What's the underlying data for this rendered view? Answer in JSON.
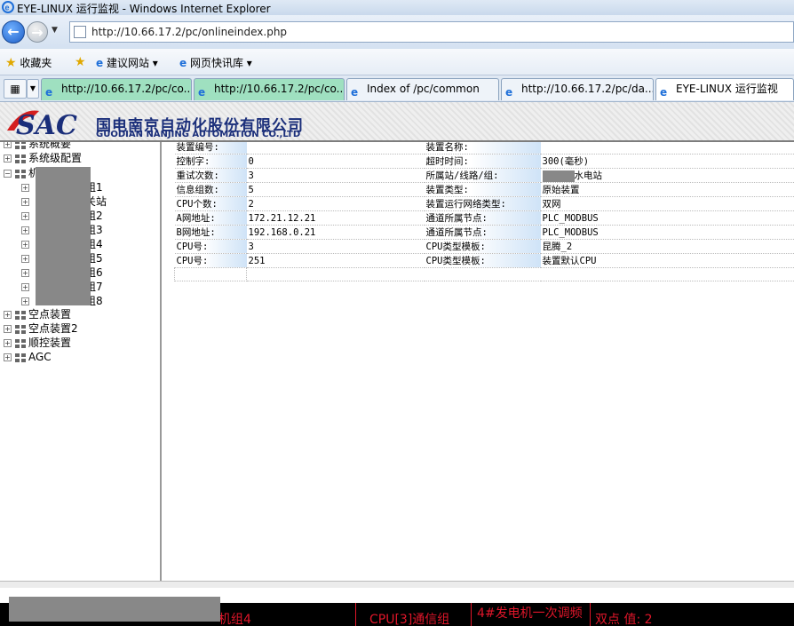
{
  "window": {
    "title": "EYE-LINUX 运行监视 - Windows Internet Explorer"
  },
  "address": {
    "url": "http://10.66.17.2/pc/onlineindex.php"
  },
  "favorites": {
    "label": "收藏夹",
    "links": [
      "建议网站 ▾",
      "网页快讯库 ▾"
    ]
  },
  "tabs": [
    {
      "label": "http://10.66.17.2/pc/co...",
      "state": "green"
    },
    {
      "label": "http://10.66.17.2/pc/co...",
      "state": "green"
    },
    {
      "label": "Index of /pc/common",
      "state": "normal"
    },
    {
      "label": "http://10.66.17.2/pc/da...",
      "state": "normal"
    },
    {
      "label": "EYE-LINUX 运行监视",
      "state": "active"
    }
  ],
  "banner": {
    "logo_text": "SAC",
    "company_cn": "国电南京自动化股份有限公司",
    "company_en": "GUODIAN NANJING AUTOMATION CO.,LTD"
  },
  "tree": {
    "top_items": [
      "系统概要",
      "系统级配置",
      "机"
    ],
    "sub_items": [
      "组1",
      "关站",
      "组2",
      "组3",
      "组4",
      "组5",
      "组6",
      "组7",
      "组8"
    ],
    "bottom_items": [
      "空点装置",
      "空点装置2",
      "顺控装置",
      "AGC"
    ]
  },
  "detail": {
    "rows": [
      {
        "l1": "装置编号:",
        "v1": "",
        "l2": "装置名称:",
        "v2": ""
      },
      {
        "l1": "控制字:",
        "v1": "0",
        "l2": "超时时间:",
        "v2": "300(毫秒)"
      },
      {
        "l1": "重试次数:",
        "v1": "3",
        "l2": "所属站/线路/组:",
        "v2": "水电站"
      },
      {
        "l1": "信息组数:",
        "v1": "5",
        "l2": "装置类型:",
        "v2": "原始装置"
      },
      {
        "l1": "CPU个数:",
        "v1": "2",
        "l2": "装置运行网络类型:",
        "v2": "双网"
      },
      {
        "l1": "A网地址:",
        "v1": "172.21.12.21",
        "l2": "通道所属节点:",
        "v2": "PLC_MODBUS"
      },
      {
        "l1": "B网地址:",
        "v1": "192.168.0.21",
        "l2": "通道所属节点:",
        "v2": "PLC_MODBUS"
      },
      {
        "l1": "CPU号:",
        "v1": "3",
        "l2": "CPU类型模板:",
        "v2": "昆腾_2"
      },
      {
        "l1": "CPU号:",
        "v1": "251",
        "l2": "CPU类型模板:",
        "v2": "装置默认CPU"
      }
    ]
  },
  "ticker": {
    "items": [
      "机组4",
      "CPU[3]通信组",
      "4#发电机一次调频",
      "双点 值: 2"
    ]
  },
  "colors": {
    "ticker_text": "#e0162a",
    "brand_blue": "#1a2e7a",
    "tab_green": "#9fe0c0"
  }
}
